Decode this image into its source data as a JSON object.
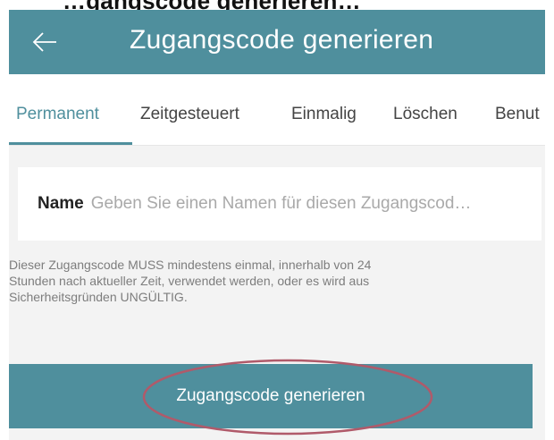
{
  "caption": {
    "text": "…gangscode generieren…"
  },
  "app_bar": {
    "back_icon": "arrow-left-icon",
    "title": "Zugangscode generieren",
    "background_color": "#4f8f9d"
  },
  "tabs": [
    {
      "label": "Permanent",
      "active": true
    },
    {
      "label": "Zeitgesteuert",
      "active": false
    },
    {
      "label": "Einmalig",
      "active": false
    },
    {
      "label": "Löschen",
      "active": false
    },
    {
      "label": "Benut",
      "active": false
    }
  ],
  "form": {
    "name_label": "Name",
    "name_placeholder": "Geben Sie einen Namen für diesen Zugangscod…",
    "name_value": ""
  },
  "hint": {
    "line1": "Dieser Zugangscode MUSS mindestens einmal, innerhalb von 24",
    "line2": "Stunden nach aktueller Zeit, verwendet werden, oder es wird aus",
    "line3": "Sicherheitsgründen UNGÜLTIG."
  },
  "generate_button": {
    "label": "Zugangscode generieren",
    "highlight_color": "#b05a6a"
  }
}
